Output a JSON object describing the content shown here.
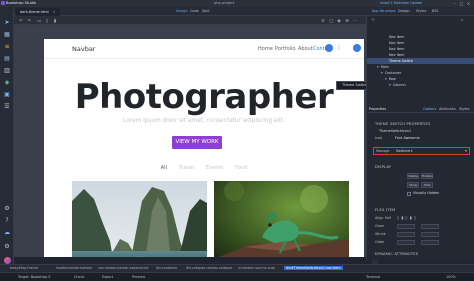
{
  "app": {
    "name": "Bootstrap Studio",
    "project_title": "php project",
    "update_note": "Install 1 Extension Update",
    "window_controls": [
      "minimize-icon",
      "maximize-icon",
      "close-icon"
    ]
  },
  "tabs": {
    "doc": "dark-theme.html",
    "modes": [
      "Design",
      "Code",
      "Split"
    ],
    "active_mode": "Design"
  },
  "page": {
    "nav": {
      "brand": "Navbar",
      "links": [
        "Home",
        "Portfolio",
        "About",
        "Contact"
      ]
    },
    "tooltip": "Theme Switch",
    "hero": {
      "title": "Photographer",
      "subtitle": "Lorem ipsum dolor sit amet, consectetur adipiscing elit.",
      "button": "VIEW MY WORK"
    },
    "filters": [
      "All",
      "Travel",
      "Events",
      "Food"
    ],
    "active_filter": "All"
  },
  "right_panel": {
    "top_tabs": [
      "App Structure",
      "Design",
      "Styles",
      "BSS"
    ],
    "tree": [
      {
        "label": "Nav Item",
        "indent": 4
      },
      {
        "label": "Nav Item",
        "indent": 4
      },
      {
        "label": "Nav Item",
        "indent": 4
      },
      {
        "label": "Nav Item",
        "indent": 4
      },
      {
        "label": "Theme Switch",
        "indent": 4,
        "selected": true
      },
      {
        "label": "Main",
        "indent": 1
      },
      {
        "label": "Container",
        "indent": 2
      },
      {
        "label": "Row",
        "indent": 3
      },
      {
        "label": "Column",
        "indent": 4
      }
    ],
    "prop_tabs": [
      "Properties",
      "Options",
      "Attributes",
      "Styles"
    ],
    "section_theme_switch": "THEME SWITCH PROPERTIES",
    "theme_switch_id": "ThemeSwitchIcon1",
    "label_icon": "Icon",
    "icon_value": "Font Awesome",
    "label_manage": "Manage",
    "manage_value": "Switcher1",
    "section_display": "DISPLAY",
    "display_options": [
      "Visible",
      "Hidden",
      "Show",
      "Hide"
    ],
    "label_visually_hidden": "Visually Hidden",
    "section_flex_item": "FLEX ITEM",
    "label_align_self": "Align Self",
    "label_grow": "Grow",
    "label_shrink": "Shrink",
    "label_order": "Order",
    "section_dynamic": "DYNAMIC ATTRIBUTES"
  },
  "breadcrumbs": [
    "body#top.theme",
    "header.border-bottom",
    "nav.navbar.navbar-expand-md",
    "div.container",
    "div.collapse.navbar-collapse",
    "ul.navbar-nav.ms-auto",
    "div#ThemeSwitchIcon1.nav-item"
  ],
  "status": {
    "target": "Target: Bootstrap 5",
    "check": "Check",
    "export": "Export",
    "preview": "Preview",
    "terminal": "Terminal",
    "zoom": "100%"
  },
  "colors": {
    "accent": "#8c3fd0",
    "selection": "#3a4d75",
    "highlight_border": "#e03a3a",
    "link_blue": "#3b7ddd"
  }
}
